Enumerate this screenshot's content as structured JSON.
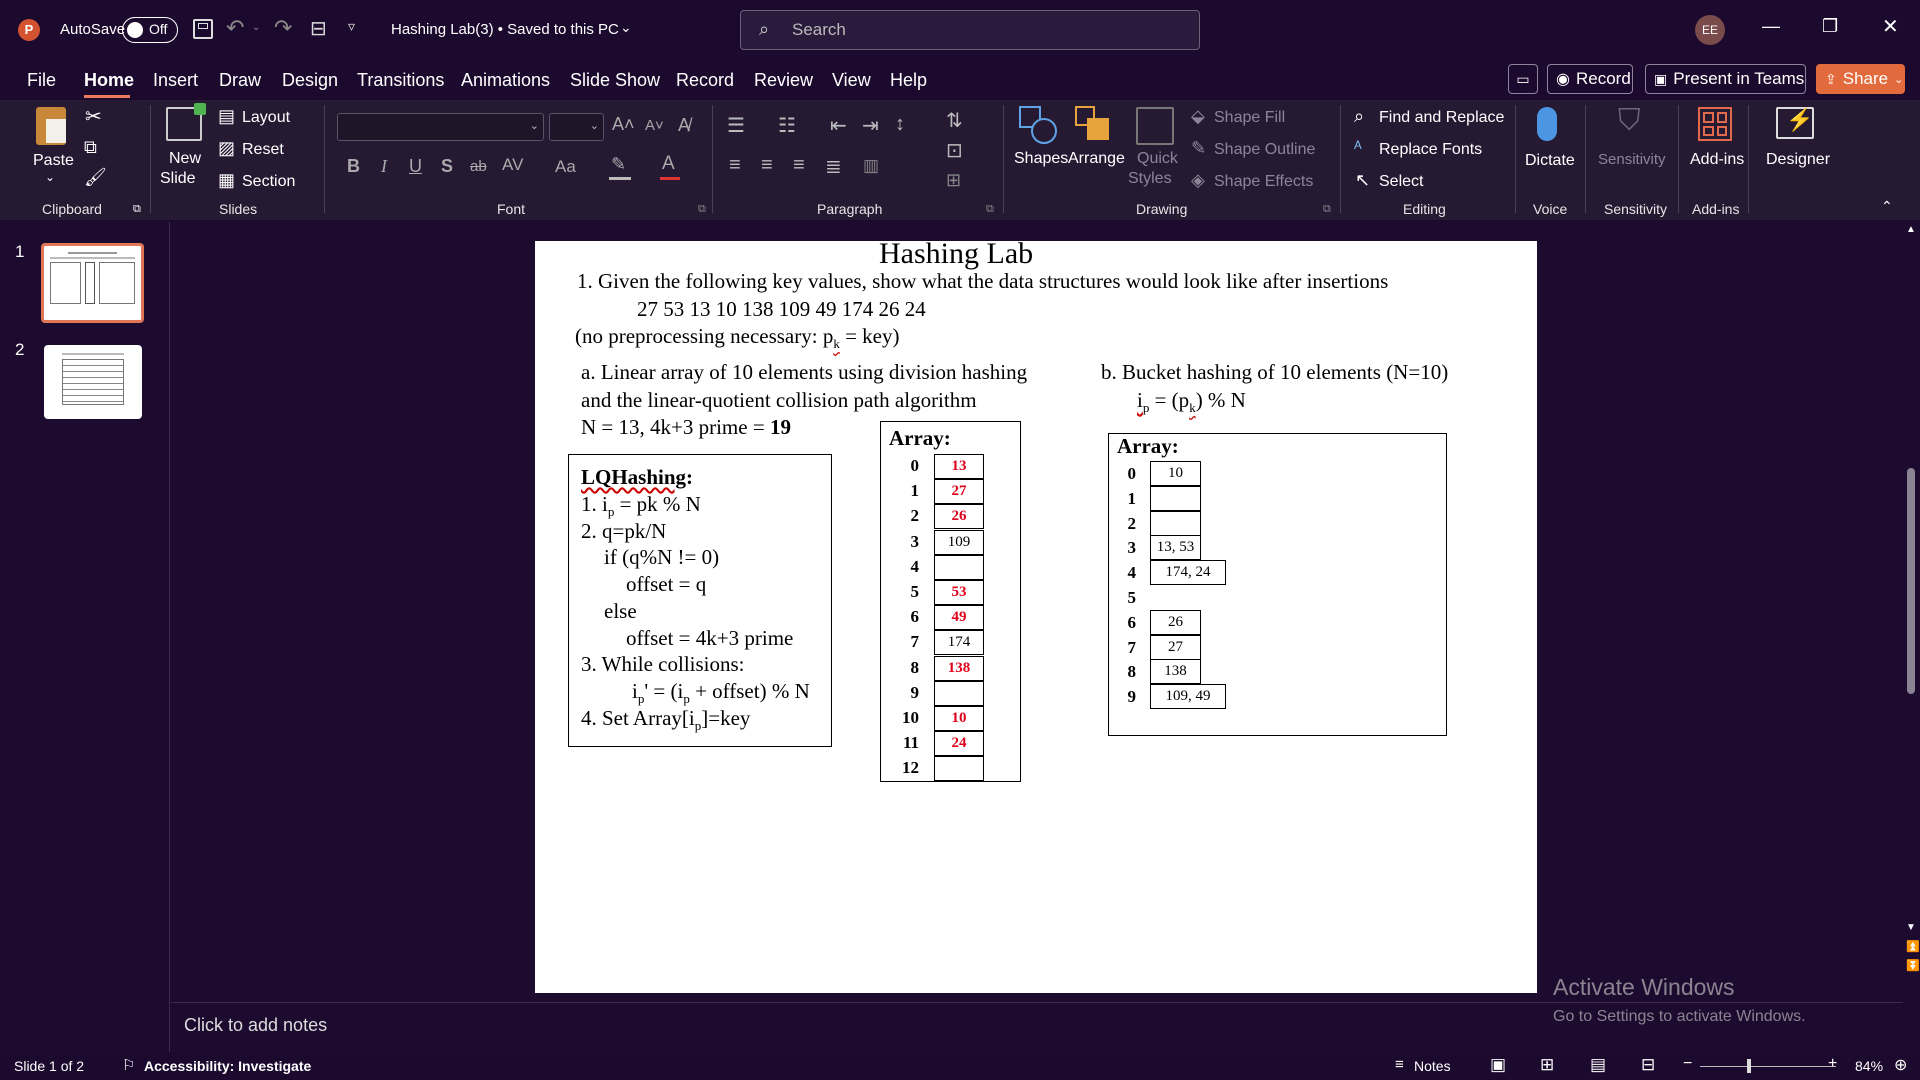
{
  "titlebar": {
    "autosave_label": "AutoSave",
    "autosave_state": "Off",
    "doc_title": "Hashing Lab(3) • Saved to this PC",
    "search_placeholder": "Search",
    "avatar_initials": "EE"
  },
  "menu": [
    "File",
    "Home",
    "Insert",
    "Draw",
    "Design",
    "Transitions",
    "Animations",
    "Slide Show",
    "Record",
    "Review",
    "View",
    "Help"
  ],
  "menu_actions": {
    "record": "Record",
    "present": "Present in Teams",
    "share": "Share"
  },
  "ribbon": {
    "clipboard": {
      "paste": "Paste",
      "group": "Clipboard"
    },
    "slides": {
      "new_slide_1": "New",
      "new_slide_2": "Slide",
      "layout": "Layout",
      "reset": "Reset",
      "section": "Section",
      "group": "Slides"
    },
    "font": {
      "group": "Font",
      "bold": "B",
      "italic": "I",
      "underline": "U",
      "shadow": "S",
      "strike": "ab",
      "case": "Aa"
    },
    "paragraph": {
      "group": "Paragraph"
    },
    "drawing": {
      "shapes": "Shapes",
      "arrange": "Arrange",
      "quick_styles_1": "Quick",
      "quick_styles_2": "Styles",
      "shape_fill": "Shape Fill",
      "shape_outline": "Shape Outline",
      "shape_effects": "Shape Effects",
      "group": "Drawing"
    },
    "editing": {
      "find_replace": "Find and Replace",
      "replace_fonts": "Replace Fonts",
      "select": "Select",
      "group": "Editing"
    },
    "voice": {
      "dictate": "Dictate",
      "group": "Voice"
    },
    "sensitivity": {
      "label": "Sensitivity",
      "group": "Sensitivity"
    },
    "addins": {
      "label": "Add-ins",
      "group": "Add-ins"
    },
    "designer": {
      "label": "Designer"
    }
  },
  "thumbnails": [
    {
      "number": "1"
    },
    {
      "number": "2"
    }
  ],
  "slide": {
    "title": "Hashing Lab",
    "q1": "1.  Given the following key values,  show what the data structures would look like after insertions",
    "keys": "27 53 13 10 138 109 49 174 26 24",
    "preproc_a": "(no preprocessing necessary:  p",
    "preproc_sub": "k",
    "preproc_b": " = key)",
    "part_a_1": "a.    Linear array of 10 elements using division hashing",
    "part_a_2": "and the linear-quotient collision path algorithm",
    "part_a_3": "N = 13, 4k+3 prime = ",
    "part_a_3_bold": "19",
    "part_b_1": "b.    Bucket hashing of 10 elements (N=10)",
    "part_b_2a": "i",
    "part_b_2sub": "p",
    "part_b_2b": " = (p",
    "part_b_2sub2": "k",
    "part_b_2c": ") % N",
    "lq": {
      "title": "LQHashing",
      "colon": ":",
      "l1a": "1. i",
      "l1sub": "p",
      "l1b": " = pk % N",
      "l2": "2. q=pk/N",
      "l3": "if (q%N != 0)",
      "l4": "offset = q",
      "l5": "else",
      "l6": "offset = 4k+3 prime",
      "l7": "3. While collisions:",
      "l8a": "i",
      "l8sub": "p",
      "l8b": "' = (i",
      "l8sub2": "p",
      "l8c": " + offset) % N",
      "l9a": "4. Set Array[i",
      "l9sub": "p",
      "l9b": "]=key"
    },
    "array_a": {
      "title": "Array:",
      "rows": [
        {
          "i": "0",
          "v": "13",
          "red": true
        },
        {
          "i": "1",
          "v": "27",
          "red": true
        },
        {
          "i": "2",
          "v": "26",
          "red": true
        },
        {
          "i": "3",
          "v": "109",
          "red": false
        },
        {
          "i": "4",
          "v": "",
          "red": false
        },
        {
          "i": "5",
          "v": "53",
          "red": true
        },
        {
          "i": "6",
          "v": "49",
          "red": true
        },
        {
          "i": "7",
          "v": "174",
          "red": false
        },
        {
          "i": "8",
          "v": "138",
          "red": true
        },
        {
          "i": "9",
          "v": "",
          "red": false
        },
        {
          "i": "10",
          "v": "10",
          "red": true
        },
        {
          "i": "11",
          "v": "24",
          "red": true
        },
        {
          "i": "12",
          "v": "",
          "red": false
        }
      ]
    },
    "array_b": {
      "title": "Array:",
      "rows": [
        {
          "i": "0",
          "v": "10",
          "wide": false
        },
        {
          "i": "1",
          "v": "",
          "wide": false
        },
        {
          "i": "2",
          "v": "",
          "wide": false
        },
        {
          "i": "3",
          "v": "13, 53",
          "wide": false
        },
        {
          "i": "4",
          "v": "174, 24",
          "wide": true
        },
        {
          "i": "5",
          "v": "",
          "wide": false,
          "nobox": true
        },
        {
          "i": "6",
          "v": "26",
          "wide": false
        },
        {
          "i": "7",
          "v": "27",
          "wide": false
        },
        {
          "i": "8",
          "v": "138",
          "wide": false
        },
        {
          "i": "9",
          "v": "109, 49",
          "wide": true
        }
      ]
    }
  },
  "notes_placeholder": "Click to add notes",
  "watermark": {
    "line1": "Activate Windows",
    "line2": "Go to Settings to activate Windows."
  },
  "status": {
    "slide_of": "Slide 1 of 2",
    "accessibility": "Accessibility: Investigate",
    "notes": "Notes",
    "zoom": "84%"
  }
}
